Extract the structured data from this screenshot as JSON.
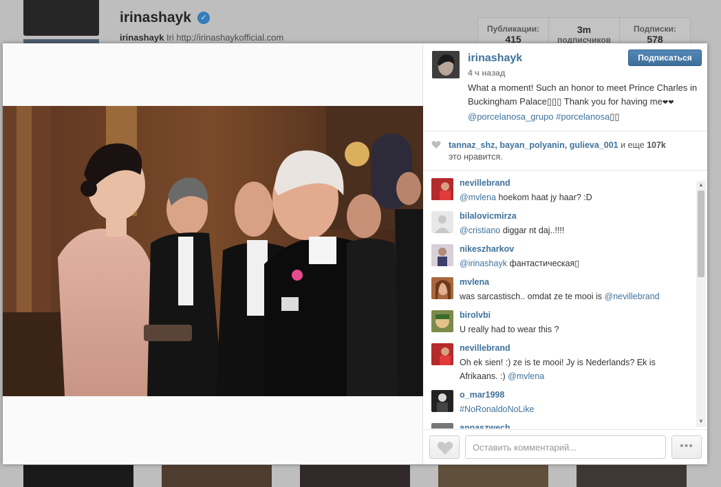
{
  "background": {
    "username": "irinashayk",
    "bio_name": "irinashayk",
    "bio_rest": " Iri http://irinashaykofficial.com",
    "stats": [
      {
        "label": "Публикации:",
        "value": "415"
      },
      {
        "label": "3m",
        "value": "подписчиков"
      },
      {
        "label": "Подписки:",
        "value": "578"
      }
    ]
  },
  "post": {
    "author": "irinashayk",
    "time_ago": "4 ч назад",
    "follow_label": "Подписаться",
    "caption_line1": "What a moment! Such an honor to meet Prince Charles in Buckingham Palace",
    "caption_emoji1": "▯▯▯",
    "caption_line2": " Thank you for having me",
    "caption_hearts": "❤❤",
    "caption_mention": "@porcelanosa_grupo",
    "caption_tag": "#porcelanosa",
    "caption_emoji2": "▯▯"
  },
  "likes": {
    "users": "tannaz_shz, bayan_polyanin, gulieva_001",
    "connector": " и еще ",
    "count": "107k",
    "suffix": "это нравится."
  },
  "comments": [
    {
      "user": "nevillebrand",
      "mention": "@mvlena",
      "text": " hoekom haat jy haar? :D"
    },
    {
      "user": "bilalovicmirza",
      "mention": "@cristiano",
      "text": " diggar nt daj..!!!!"
    },
    {
      "user": "nikeszharkov",
      "mention": "@irinashayk",
      "text": " фантастическая▯"
    },
    {
      "user": "mvlena",
      "text": "was sarcastisch.. omdat ze te mooi is ",
      "mention_after": "@nevillebrand"
    },
    {
      "user": "birolvbi",
      "text": "U really had to wear this ?"
    },
    {
      "user": "nevillebrand",
      "text": "Oh ek sien! :) ze is te mooi! Jy is Nederlands? Ek is Afrikaans. :) ",
      "mention_after": "@mvlena"
    },
    {
      "user": "o_mar1998",
      "mention": "#NoRonaldoNoLike",
      "text": ""
    },
    {
      "user": "annaszwech",
      "text": ""
    }
  ],
  "comment_input": {
    "placeholder": "Оставить комментарий..."
  },
  "more_label": "•••",
  "colors": {
    "link": "#3f729b",
    "follow_button": "#4a7ca8"
  },
  "icons": {
    "like": "heart-icon",
    "more": "ellipsis-icon",
    "verified": "verified-badge-icon"
  }
}
